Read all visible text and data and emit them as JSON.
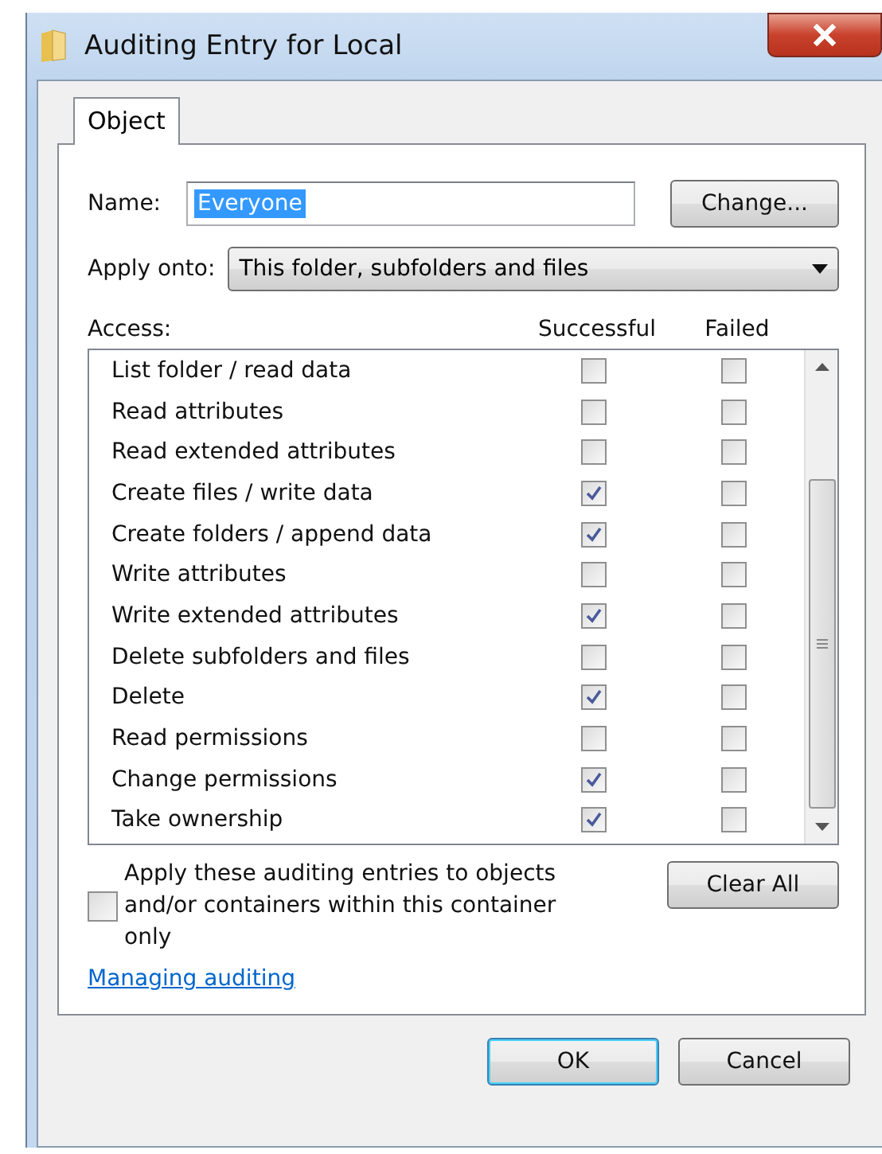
{
  "window": {
    "title": "Auditing Entry for Local"
  },
  "tabs": [
    {
      "label": "Object",
      "selected": true
    }
  ],
  "name_field": {
    "label": "Name:",
    "value": "Everyone",
    "text_selected": true
  },
  "change_button": "Change...",
  "apply_onto": {
    "label": "Apply onto:",
    "value": "This folder, subfolders and files"
  },
  "access": {
    "label": "Access:",
    "columns": [
      "Successful",
      "Failed"
    ],
    "rows": [
      {
        "name": "List folder / read data",
        "successful": false,
        "failed": false
      },
      {
        "name": "Read attributes",
        "successful": false,
        "failed": false
      },
      {
        "name": "Read extended attributes",
        "successful": false,
        "failed": false
      },
      {
        "name": "Create files / write data",
        "successful": true,
        "failed": false
      },
      {
        "name": "Create folders / append data",
        "successful": true,
        "failed": false
      },
      {
        "name": "Write attributes",
        "successful": false,
        "failed": false
      },
      {
        "name": "Write extended attributes",
        "successful": true,
        "failed": false
      },
      {
        "name": "Delete subfolders and files",
        "successful": false,
        "failed": false
      },
      {
        "name": "Delete",
        "successful": true,
        "failed": false
      },
      {
        "name": "Read permissions",
        "successful": false,
        "failed": false
      },
      {
        "name": "Change permissions",
        "successful": true,
        "failed": false
      },
      {
        "name": "Take ownership",
        "successful": true,
        "failed": false
      }
    ]
  },
  "apply_checkbox": {
    "label": "Apply these auditing entries to objects and/or containers within this container only",
    "checked": false
  },
  "clear_all_button": "Clear All",
  "help_link": "Managing auditing",
  "buttons": [
    {
      "label": "OK",
      "default": true
    },
    {
      "label": "Cancel",
      "default": false
    }
  ]
}
